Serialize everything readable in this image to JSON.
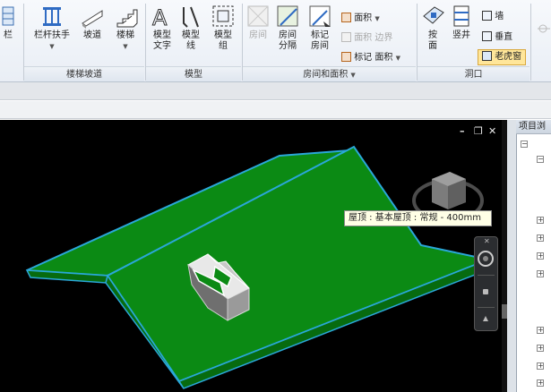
{
  "ribbon": {
    "edge_label": "栏",
    "stairs": {
      "railing": "栏杆扶手",
      "ramp": "坡道",
      "stair": "楼梯",
      "panel": "楼梯坡道"
    },
    "model": {
      "model_text_1": "模型",
      "model_text_2": "文字",
      "model_line_1": "模型",
      "model_line_2": "线",
      "model_group_1": "模型",
      "model_group_2": "组",
      "panel": "模型"
    },
    "rooms": {
      "room": "房间",
      "room_sep_1": "房间",
      "room_sep_2": "分隔",
      "tag_room_1": "标记",
      "tag_room_2": "房间",
      "area": "面积",
      "area_boundary_1": "面积",
      "area_boundary_2": "边界",
      "tag_area_1": "标记",
      "tag_area_2": "面积",
      "panel": "房间和面积"
    },
    "opening": {
      "by_face_1": "按",
      "by_face_2": "面",
      "shaft": "竖井",
      "wall": "墙",
      "vertical": "垂直",
      "dormer": "老虎窗",
      "panel": "洞口"
    }
  },
  "viewport": {
    "tooltip": "屋顶 : 基本屋顶 : 常规 - 400mm",
    "controls": {
      "minimize": "–",
      "restore": "❐",
      "close": "✕"
    },
    "colors": {
      "background": "#000000",
      "roof_fill": "#0b8a14",
      "roof_edge": "#2aa7d8"
    }
  },
  "browser": {
    "title": "项目浏"
  }
}
